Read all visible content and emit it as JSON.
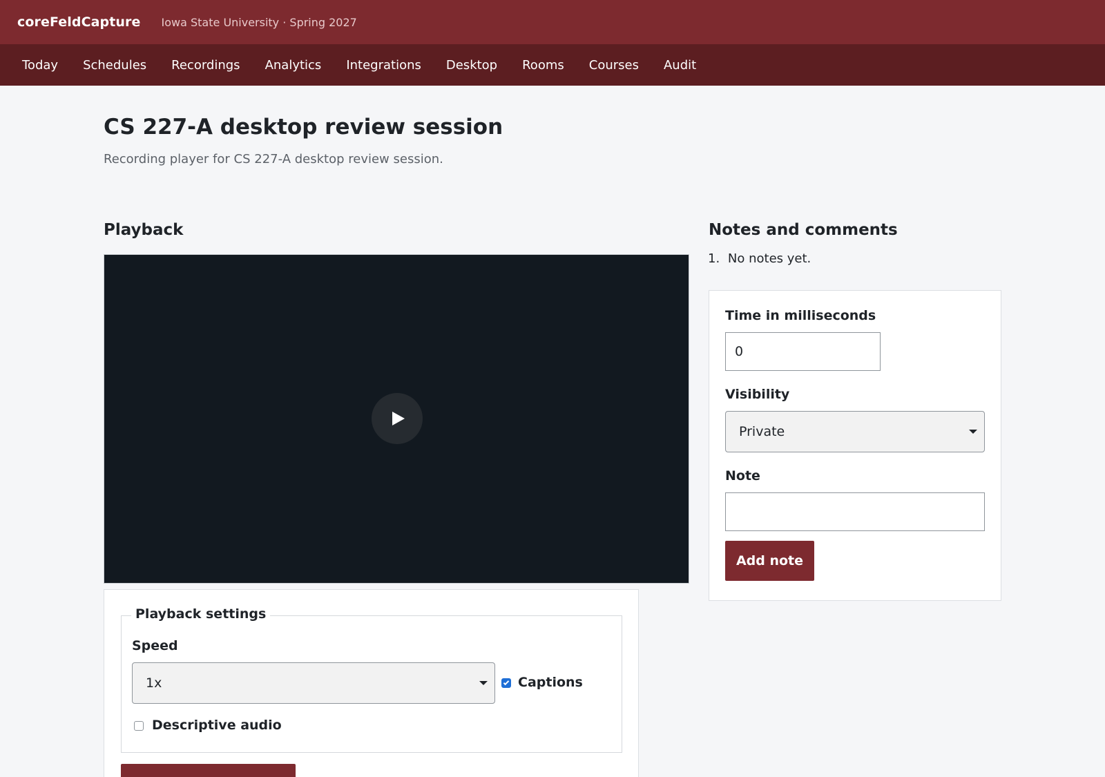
{
  "header": {
    "brand": "coreFeldCapture",
    "institution": "Iowa State University · Spring 2027"
  },
  "nav": {
    "items": [
      "Today",
      "Schedules",
      "Recordings",
      "Analytics",
      "Integrations",
      "Desktop",
      "Rooms",
      "Courses",
      "Audit"
    ]
  },
  "page": {
    "title": "CS 227-A desktop review session",
    "subtitle": "Recording player for CS 227-A desktop review session."
  },
  "playback": {
    "heading": "Playback",
    "play_icon": "play-icon",
    "settings": {
      "legend": "Playback settings",
      "speed_label": "Speed",
      "speed_value": "1x",
      "captions_label": "Captions",
      "captions_checked": true,
      "descriptive_audio_label": "Descriptive audio",
      "descriptive_audio_checked": false
    }
  },
  "notes": {
    "heading": "Notes and comments",
    "list_number": "1.",
    "empty_text": "No notes yet.",
    "time_label": "Time in milliseconds",
    "time_value": "0",
    "visibility_label": "Visibility",
    "visibility_value": "Private",
    "note_label": "Note",
    "note_value": "",
    "add_button_label": "Add note"
  },
  "colors": {
    "brand": "#7d2a2f",
    "nav_background": "#5c1e21",
    "video_background": "#121920",
    "checkbox_accent": "#1f6fd6"
  }
}
